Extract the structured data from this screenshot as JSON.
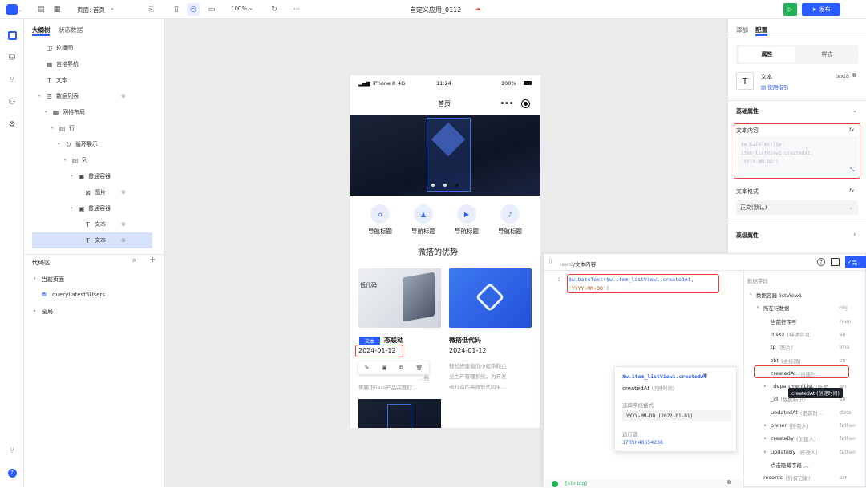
{
  "topbar": {
    "page_label": "页面: 首页",
    "zoom": "100%",
    "app_title": "自定义应用_0112",
    "publish": "发布"
  },
  "left": {
    "tabs": [
      "大纲树",
      "状态数据"
    ],
    "tree": [
      {
        "label": "轮播图",
        "icon": "carousel-icon",
        "indent": 0,
        "tri": ""
      },
      {
        "label": "宫格导航",
        "icon": "grid-nav-icon",
        "indent": 0,
        "tri": ""
      },
      {
        "label": "文本",
        "icon": "text-icon",
        "indent": 0,
        "tri": ""
      },
      {
        "label": "数据列表",
        "icon": "list-icon",
        "indent": 0,
        "tri": "▾",
        "eye": true
      },
      {
        "label": "网格布局",
        "icon": "grid-icon",
        "indent": 1,
        "tri": "▾"
      },
      {
        "label": "行",
        "icon": "row-icon",
        "indent": 2,
        "tri": "▾"
      },
      {
        "label": "循环展示",
        "icon": "loop-icon",
        "indent": 3,
        "tri": "▾"
      },
      {
        "label": "列",
        "icon": "column-icon",
        "indent": 4,
        "tri": "▾"
      },
      {
        "label": "普通容器",
        "icon": "container-icon",
        "indent": 5,
        "tri": "▾"
      },
      {
        "label": "图片",
        "icon": "image-icon",
        "indent": 6,
        "tri": "",
        "eye": true
      },
      {
        "label": "普通容器",
        "icon": "container-icon",
        "indent": 5,
        "tri": "▾"
      },
      {
        "label": "文本",
        "icon": "text-icon",
        "indent": 6,
        "tri": "",
        "eye": true
      },
      {
        "label": "文本",
        "icon": "text-icon",
        "indent": 6,
        "tri": "",
        "eye": true,
        "sel": true
      }
    ],
    "code_area": "代码区",
    "current_page": "当前页面",
    "query": "queryLatest5Users",
    "global": "全局"
  },
  "phone": {
    "status": {
      "carrier": "iPhone 8",
      "net": "4G",
      "time": "11:24",
      "battery": "100%"
    },
    "nav_title": "首页",
    "nav_items": [
      "导航标题",
      "导航标题",
      "导航标题",
      "导航标题"
    ],
    "section_title": "微搭的优势",
    "card1": {
      "img_text": "低代码",
      "title": "态联动",
      "tag": "文本",
      "date": "2024-01-12",
      "desc1": "…档",
      "desc2": "等腾讯Sass产品深度打…"
    },
    "card2": {
      "title": "微搭低代码",
      "date": "2024-01-12",
      "desc1": "轻松搭建微信小程序和企",
      "desc2": "业生产管理系统，为开发",
      "desc3": "者打造的高效低代码平…"
    }
  },
  "right": {
    "tabs": [
      "添加",
      "配置"
    ],
    "seg": [
      "属性",
      "样式"
    ],
    "comp_name": "文本",
    "comp_id": "text8",
    "guide": "使用指引",
    "basic": "基础属性",
    "content_label": "文本内容",
    "content_code": "$w.DateText($w.\nitem_listView1.createdAt,\n'YYYY-MM-DD')",
    "format_label": "文本格式",
    "format_value": "正文(默认)",
    "advanced": "高级属性",
    "fx": "fx"
  },
  "code": {
    "path_a": "text8",
    "path_b": "/文本内容",
    "line_no": "1",
    "line1": "$w.DateText($w.item_listView1.createdAt,",
    "line2": "'YYYY-MM-DD')",
    "complete": "完",
    "popup": {
      "title": "$w.item_listView1.createdAt",
      "name": "createdAt",
      "sub": "(创建时间)",
      "fmt_label": "选择字段格式",
      "fmt_value": "YYYY-MM-DD (2022-01-01)",
      "run_label": "运行值",
      "run_value": "1705040554238"
    },
    "status": "{string}",
    "fields_title": "数据字段",
    "fields": [
      {
        "tri": "▾",
        "name": "数据容器 listView1",
        "sub": "",
        "typ": "",
        "indent": 0
      },
      {
        "tri": "▾",
        "name": "所在行数据",
        "sub": "",
        "typ": "obj",
        "indent": 1
      },
      {
        "tri": "",
        "name": "当前行序号",
        "sub": "",
        "typ": "num",
        "indent": 2
      },
      {
        "tri": "",
        "name": "msxx",
        "sub": "(描述信息)",
        "typ": "str",
        "indent": 2
      },
      {
        "tri": "",
        "name": "tp",
        "sub": "(图片)",
        "typ": "ima",
        "indent": 2
      },
      {
        "tri": "",
        "name": "zbt",
        "sub": "(主标题)",
        "typ": "str",
        "indent": 2
      },
      {
        "tri": "",
        "name": "createdAt",
        "sub": "(创建时…",
        "typ": "",
        "indent": 2
      },
      {
        "tri": "▸",
        "name": "_departmentList",
        "sub": "(所属…",
        "typ": "arr",
        "indent": 2
      },
      {
        "tri": "",
        "name": "_id",
        "sub": "(数据标识)",
        "typ": "str",
        "indent": 2
      },
      {
        "tri": "",
        "name": "updatedAt",
        "sub": "(更新时…",
        "typ": "date",
        "indent": 2
      },
      {
        "tri": "▸",
        "name": "owner",
        "sub": "(所有人)",
        "typ": "father-",
        "indent": 2
      },
      {
        "tri": "▸",
        "name": "createBy",
        "sub": "(创建人)",
        "typ": "father-",
        "indent": 2
      },
      {
        "tri": "▸",
        "name": "updateBy",
        "sub": "(修改人)",
        "typ": "father-",
        "indent": 2
      },
      {
        "tri": "",
        "name": "点击隐藏字段 ︿",
        "sub": "",
        "typ": "",
        "indent": 2
      },
      {
        "tri": "",
        "name": "records",
        "sub": "(列表记录)",
        "typ": "arr",
        "indent": 1
      }
    ],
    "tooltip": "createdAt (创建时间)"
  },
  "colors": {
    "accent": "#2b5cff",
    "highlight": "#e0432e",
    "green": "#1fb155"
  }
}
